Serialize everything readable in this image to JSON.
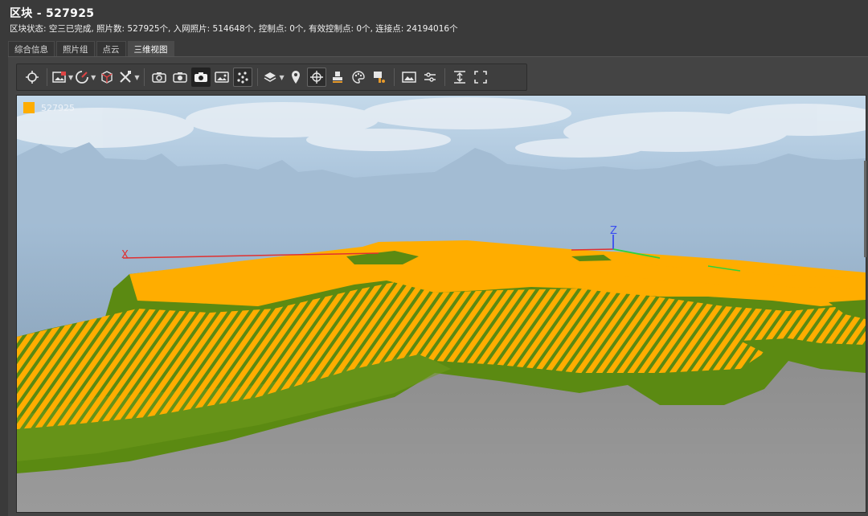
{
  "window": {
    "title": "区块 - 527925",
    "status_line": "区块状态: 空三已完成, 照片数: 527925个, 入网照片: 514648个, 控制点: 0个, 有效控制点: 0个, 连接点: 24194016个"
  },
  "tabs": [
    {
      "label": "综合信息",
      "active": false
    },
    {
      "label": "照片组",
      "active": false
    },
    {
      "label": "点云",
      "active": false
    },
    {
      "label": "三维视图",
      "active": true
    }
  ],
  "toolbar": {
    "tools": [
      "view-center-icon",
      "photo-dropdown-icon",
      "color-mode-icon",
      "cube-icon",
      "measure-tools-icon",
      "camera-rotate-icon",
      "camera-reset-icon",
      "camera-icon",
      "image-icon",
      "points-icon",
      "layers-icon",
      "location-pin-icon",
      "crosshair-icon",
      "stamp-icon",
      "palette-icon",
      "paint-icon",
      "picture-icon",
      "sliders-icon",
      "fit-vertical-icon",
      "fit-extent-icon"
    ],
    "active_tool": "crosshair-icon"
  },
  "viewport": {
    "legend": {
      "label": "527925",
      "color": "#ffad00"
    },
    "axes": {
      "x_label": "X",
      "z_label": "Z"
    },
    "colors": {
      "sky_top": "#b6cfe6",
      "sky_bottom": "#8aa4be",
      "ground": "#8a8a8a",
      "terrain": "#5b8a12",
      "points": "#ffad00",
      "axis_x": "#e03030",
      "axis_y": "#2ed23a",
      "axis_z": "#3a4df0"
    }
  }
}
